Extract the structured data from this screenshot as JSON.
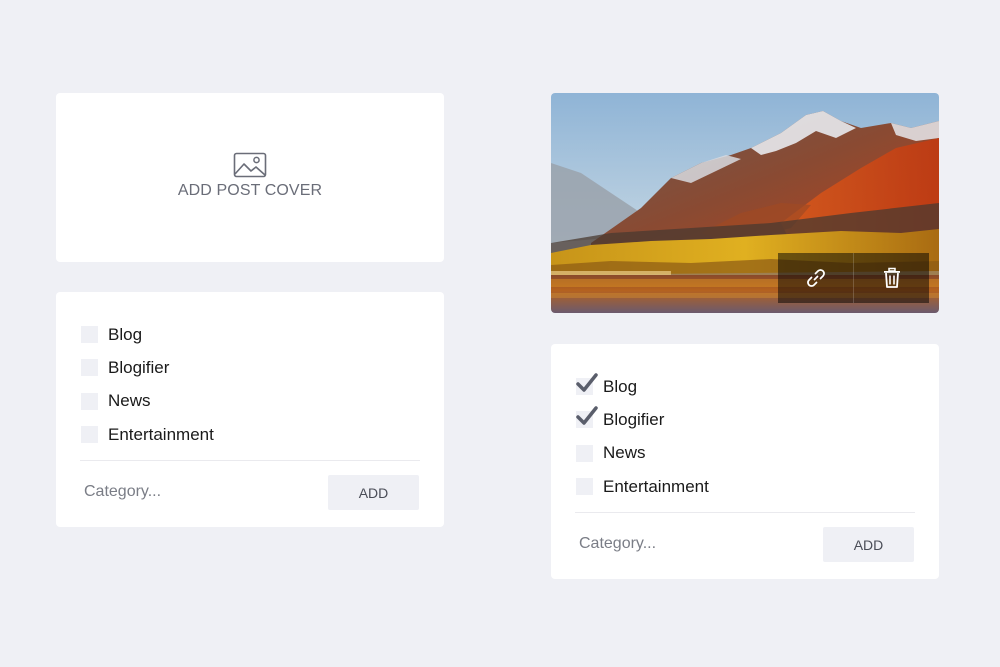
{
  "cover_upload": {
    "icon": "image-icon",
    "label": "ADD POST COVER"
  },
  "cover_preview": {
    "image": "mountain-landscape",
    "actions": {
      "link_icon": "link-icon",
      "delete_icon": "trash-icon"
    }
  },
  "categories_left": {
    "items": [
      {
        "label": "Blog",
        "checked": false
      },
      {
        "label": "Blogifier",
        "checked": false
      },
      {
        "label": "News",
        "checked": false
      },
      {
        "label": "Entertainment",
        "checked": false
      }
    ],
    "input": {
      "value": "",
      "placeholder": "Category..."
    },
    "add_label": "ADD"
  },
  "categories_right": {
    "items": [
      {
        "label": "Blog",
        "checked": true
      },
      {
        "label": "Blogifier",
        "checked": true
      },
      {
        "label": "News",
        "checked": false
      },
      {
        "label": "Entertainment",
        "checked": false
      }
    ],
    "input": {
      "value": "",
      "placeholder": "Category..."
    },
    "add_label": "ADD"
  },
  "colors": {
    "background": "#eff0f5",
    "card": "#ffffff",
    "checkmark": "#5a5e6b"
  }
}
